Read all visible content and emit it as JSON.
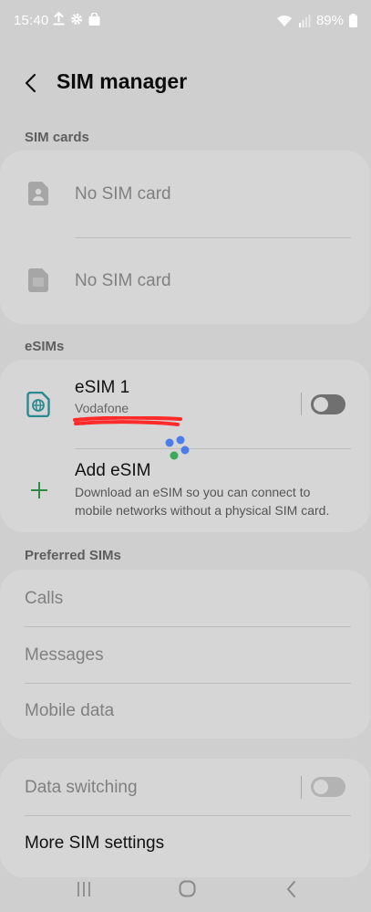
{
  "status_bar": {
    "time": "15:40",
    "battery": "89%",
    "icons": [
      "upload-icon",
      "gear-icon",
      "bag-icon",
      "wifi-icon",
      "signal-icon",
      "battery-icon"
    ]
  },
  "header": {
    "title": "SIM manager"
  },
  "sim_cards": {
    "heading": "SIM cards",
    "items": [
      {
        "label": "No SIM card",
        "icon": "sim-card-person-icon"
      },
      {
        "label": "No SIM card",
        "icon": "sim-card-icon"
      }
    ]
  },
  "esims": {
    "heading": "eSIMs",
    "esim1": {
      "name": "eSIM 1",
      "carrier": "Vodafone",
      "enabled": false,
      "icon": "esim-globe-icon"
    },
    "add": {
      "title": "Add eSIM",
      "description_line1": "Download an eSIM so you can connect to",
      "description_line2": "mobile networks without a physical SIM card.",
      "icon": "plus-icon"
    }
  },
  "preferred_sims": {
    "heading": "Preferred SIMs",
    "items": [
      "Calls",
      "Messages",
      "Mobile data"
    ]
  },
  "more": {
    "data_switching": {
      "label": "Data switching",
      "enabled": false
    },
    "more_sim_settings": {
      "label": "More SIM settings"
    }
  },
  "colors": {
    "accent_teal": "#2a8a94",
    "plus_green": "#2e8b45",
    "redaction_red": "#ff2a2a",
    "loader_blue": "#4a7de8",
    "loader_green": "#3aaa5a"
  }
}
